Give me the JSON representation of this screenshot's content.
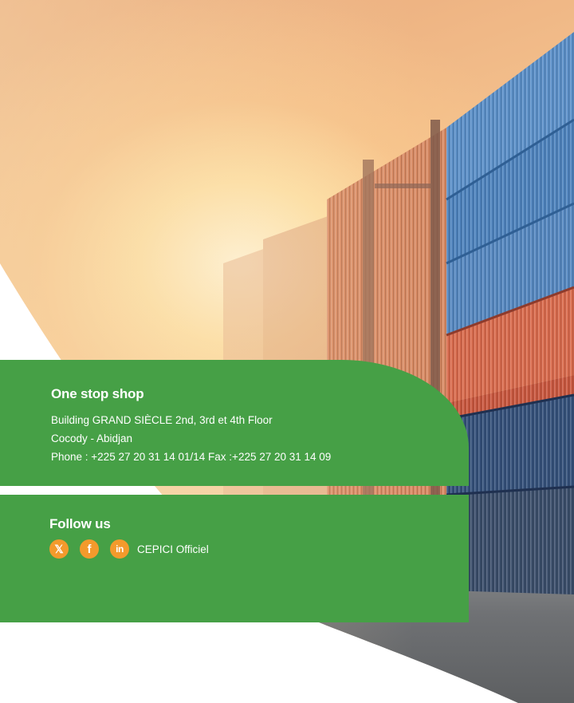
{
  "contact": {
    "title": "One stop shop",
    "address_line1": "Building GRAND SIÈCLE 2nd, 3rd et 4th Floor",
    "address_line2": "Cocody - Abidjan",
    "phone_line": "Phone : +225 27 20 31 14 01/14 Fax :+225 27 20 31 14 09"
  },
  "follow": {
    "title": "Follow us",
    "icons": [
      {
        "name": "x-icon",
        "glyph": "𝕏"
      },
      {
        "name": "facebook-icon",
        "glyph": "f"
      },
      {
        "name": "linkedin-icon",
        "glyph": "in"
      }
    ],
    "account_label": "CEPICI Officiel"
  },
  "colors": {
    "panel_green": "#46a046",
    "icon_orange": "#f39a2c",
    "text": "#ffffff"
  }
}
